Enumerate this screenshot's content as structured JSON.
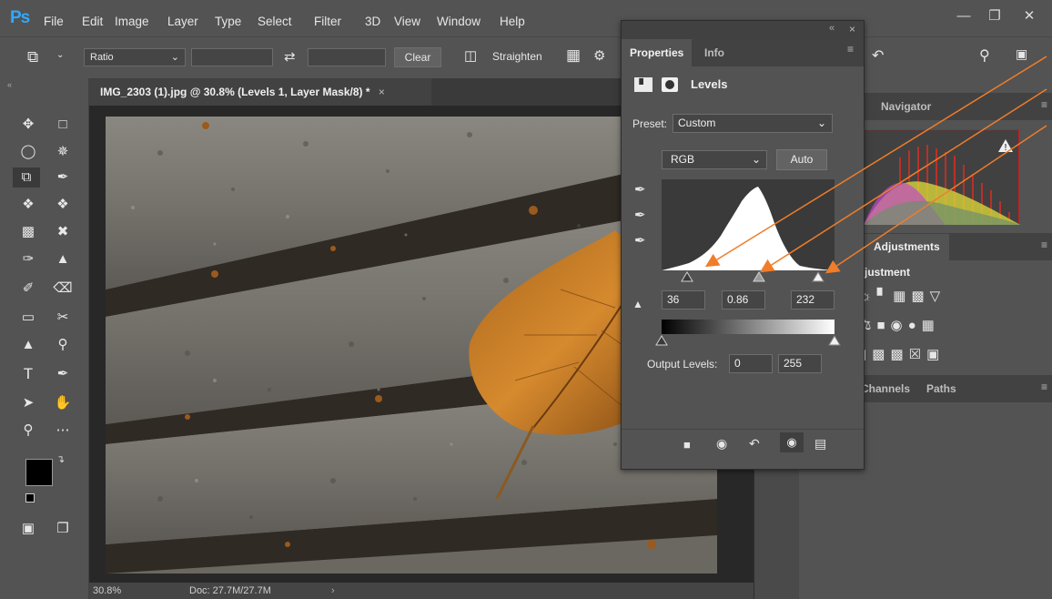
{
  "app": {
    "logo": "Ps",
    "menu": [
      "File",
      "Edit",
      "Image",
      "Layer",
      "Type",
      "Select",
      "Filter",
      "3D",
      "View",
      "Window",
      "Help"
    ]
  },
  "options_bar": {
    "ratio_label": "Ratio",
    "clear_label": "Clear",
    "straighten_label": "Straighten"
  },
  "document": {
    "tab_title": "IMG_2303 (1).jpg @ 30.8% (Levels 1, Layer Mask/8) *",
    "close_glyph": "×",
    "zoom": "30.8%",
    "doc_size": "Doc: 27.7M/27.7M"
  },
  "properties": {
    "tabs": [
      "Properties",
      "Info"
    ],
    "title": "Levels",
    "preset_label": "Preset:",
    "preset_value": "Custom",
    "channel_value": "RGB",
    "auto_label": "Auto",
    "input_black": "36",
    "input_gamma": "0.86",
    "input_white": "232",
    "output_label": "Output Levels:",
    "output_black": "0",
    "output_white": "255",
    "collapse_glyph": "«",
    "close_glyph": "×"
  },
  "panels": {
    "navigator": "Navigator",
    "adjustments": "Adjustments",
    "adjustments_partial": "justment",
    "channels": "Channels",
    "paths": "Paths"
  },
  "colors": {
    "accent_arrow": "#f07d2a",
    "ps_blue": "#31a8ff",
    "foreground": "#000000",
    "background": "#ffffff"
  }
}
